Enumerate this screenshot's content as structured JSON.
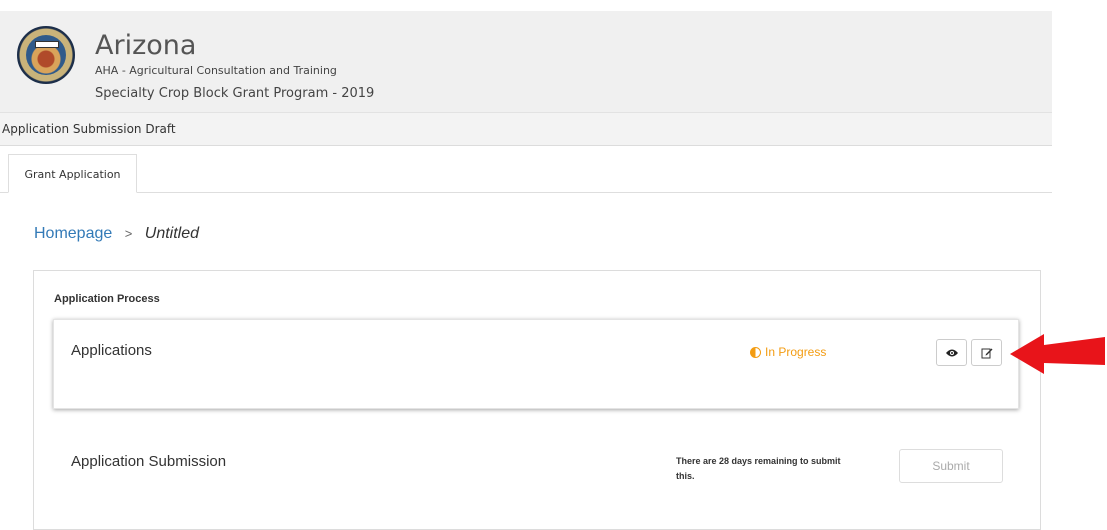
{
  "header": {
    "state_name": "Arizona",
    "org_name": "AHA - Agricultural Consultation and Training",
    "program_name": "Specialty Crop Block Grant Program - 2019"
  },
  "subbar": {
    "title": "Application Submission Draft"
  },
  "tabs": [
    {
      "label": "Grant Application",
      "active": true
    }
  ],
  "breadcrumb": {
    "home": "Homepage",
    "separator": ">",
    "current": "Untitled"
  },
  "process": {
    "title": "Application Process",
    "applications": {
      "title": "Applications",
      "status": "In Progress",
      "status_color": "#f39c12",
      "actions": [
        {
          "icon": "eye-icon"
        },
        {
          "icon": "edit-icon"
        }
      ]
    },
    "submission": {
      "title": "Application Submission",
      "remaining_text": "There are 28 days remaining to submit this.",
      "submit_label": "Submit"
    }
  },
  "colors": {
    "link": "#337ab7",
    "annotation_arrow": "#e8141a"
  }
}
